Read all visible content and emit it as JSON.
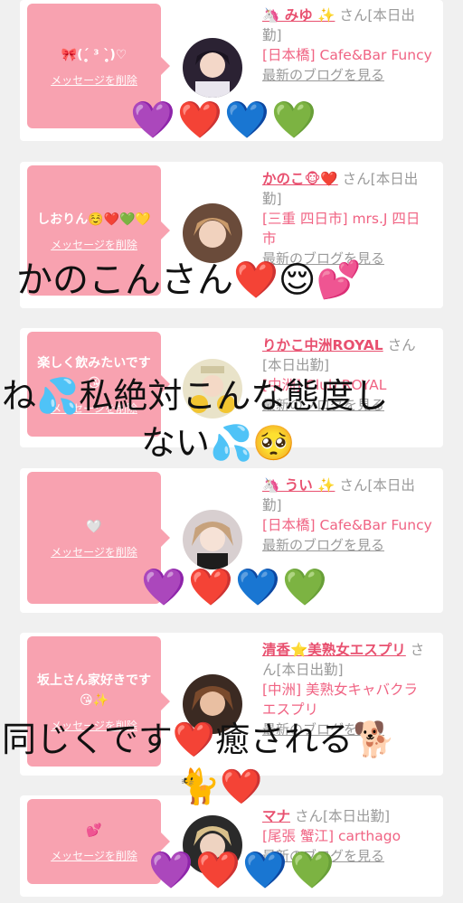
{
  "cards": [
    {
      "message": "🎀(ˊ̥̥̥̥̥ ³ ˋ̥̥̥̥̥)♡",
      "delete_label": "メッセージを削除",
      "name": "🦄 みゆ ✨",
      "san": "さん[本日出勤]",
      "shop": "[日本橋] Cafe&Bar Funcy",
      "blog": "最新のブログを見る"
    },
    {
      "message": "しおりん☺️❤️💚💛",
      "delete_label": "メッセージを削除",
      "name": "かのこ🐵❤️",
      "san": "さん[本日出勤]",
      "shop": "[三重 四日市] mrs.J 四日市",
      "blog": "最新のブログを見る"
    },
    {
      "message": "楽しく飲みたいです😘",
      "delete_label": "メッセージを削除",
      "name": "りかこ中洲ROYAL",
      "san": "さん[本日出勤]",
      "shop": "[中洲] Club ROYAL",
      "blog": "最新のブログを見る"
    },
    {
      "message": "🤍",
      "delete_label": "メッセージを削除",
      "name": "🦄 うい ✨",
      "san": "さん[本日出勤]",
      "shop": "[日本橋] Cafe&Bar Funcy",
      "blog": "最新のブログを見る"
    },
    {
      "message": "坂上さん家好きです😘✨",
      "delete_label": "メッセージを削除",
      "name": "清香⭐美熟女エスプリ",
      "san": "さん[本日出勤]",
      "shop": "[中洲] 美熟女キャバクラ エスプリ",
      "blog": "最新のブログを見る"
    },
    {
      "message": "💕",
      "delete_label": "メッセージを削除",
      "name": "マナ",
      "san": "さん[本日出勤]",
      "shop": "[尾張 蟹江] carthago",
      "blog": "最新のブログを見る"
    }
  ],
  "overlays": {
    "line1": "かのこんさん❤️😌💕",
    "line2": "ね💦私絶対こんな態度し",
    "line3": "ない💦🥺",
    "line4": "同じくです❤️癒される🐕",
    "line5": "🐈❤️"
  },
  "hearts": [
    "💜",
    "❤️",
    "💙",
    "💚"
  ],
  "colors": {
    "bubble": "#f8a2b0",
    "name": "#e8506f",
    "background": "#f0f0f0"
  }
}
